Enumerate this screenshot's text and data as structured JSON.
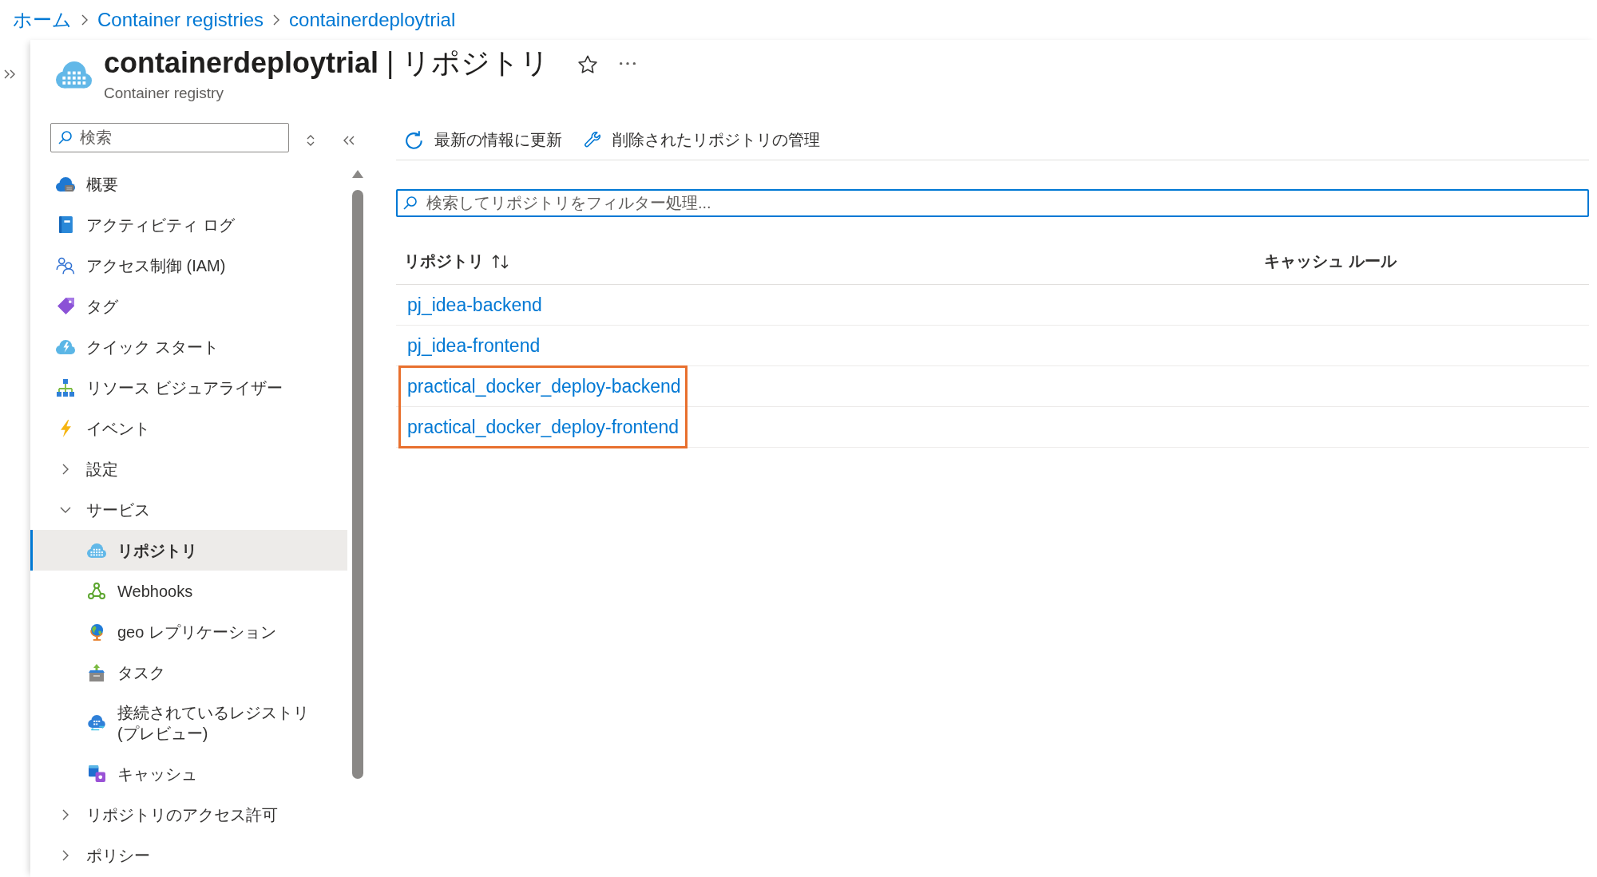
{
  "breadcrumb": [
    {
      "label": "ホーム"
    },
    {
      "label": "Container registries"
    },
    {
      "label": "containerdeploytrial"
    }
  ],
  "header": {
    "title": "**containerdeploytrial** | リポジトリ",
    "subtitle": "Container registry"
  },
  "sidebar": {
    "search": {
      "placeholder": "検索"
    },
    "items": [
      {
        "kind": "link",
        "label": "概要",
        "selected": false
      },
      {
        "kind": "link",
        "label": "アクティビティ ログ",
        "selected": false
      },
      {
        "kind": "link",
        "label": "アクセス制御 (IAM)",
        "selected": false
      },
      {
        "kind": "link",
        "label": "タグ",
        "selected": false
      },
      {
        "kind": "link",
        "label": "クイック スタート",
        "selected": false
      },
      {
        "kind": "link",
        "label": "リソース ビジュアライザー",
        "selected": false
      },
      {
        "kind": "link",
        "label": "イベント",
        "selected": false
      },
      {
        "kind": "group",
        "label": "設定",
        "expanded": false,
        "selected": false
      },
      {
        "kind": "group",
        "label": "サービス",
        "expanded": true,
        "selected": false,
        "children": [
          {
            "kind": "link",
            "label": "リポジトリ",
            "selected": true
          },
          {
            "kind": "link",
            "label": "Webhooks",
            "selected": false
          },
          {
            "kind": "link",
            "label": "geo レプリケーション",
            "selected": false
          },
          {
            "kind": "link",
            "label": "タスク",
            "selected": false
          },
          {
            "kind": "link",
            "label": "接続されているレジストリ (プレビュー)",
            "selected": false
          },
          {
            "kind": "link",
            "label": "キャッシュ",
            "selected": false
          }
        ]
      },
      {
        "kind": "group",
        "label": "リポジトリのアクセス許可",
        "expanded": false,
        "selected": false
      },
      {
        "kind": "group",
        "label": "ポリシー",
        "expanded": false,
        "selected": false
      }
    ]
  },
  "toolbar": {
    "buttons": [
      {
        "label": "最新の情報に更新"
      },
      {
        "label": "削除されたリポジトリの管理"
      }
    ]
  },
  "filter": {
    "placeholder": "検索してリポジトリをフィルター処理...",
    "focused": true
  },
  "table": {
    "columns": [
      {
        "label": "リポジトリ",
        "sortable": true
      },
      {
        "label": "キャッシュ ルール",
        "sortable": false
      }
    ],
    "rows": [
      {
        "name": "pj_idea-backend",
        "highlighted": false
      },
      {
        "name": "pj_idea-frontend",
        "highlighted": false
      },
      {
        "name": "practical_docker_deploy-backend",
        "highlighted": true
      },
      {
        "name": "practical_docker_deploy-frontend",
        "highlighted": true
      }
    ]
  }
}
